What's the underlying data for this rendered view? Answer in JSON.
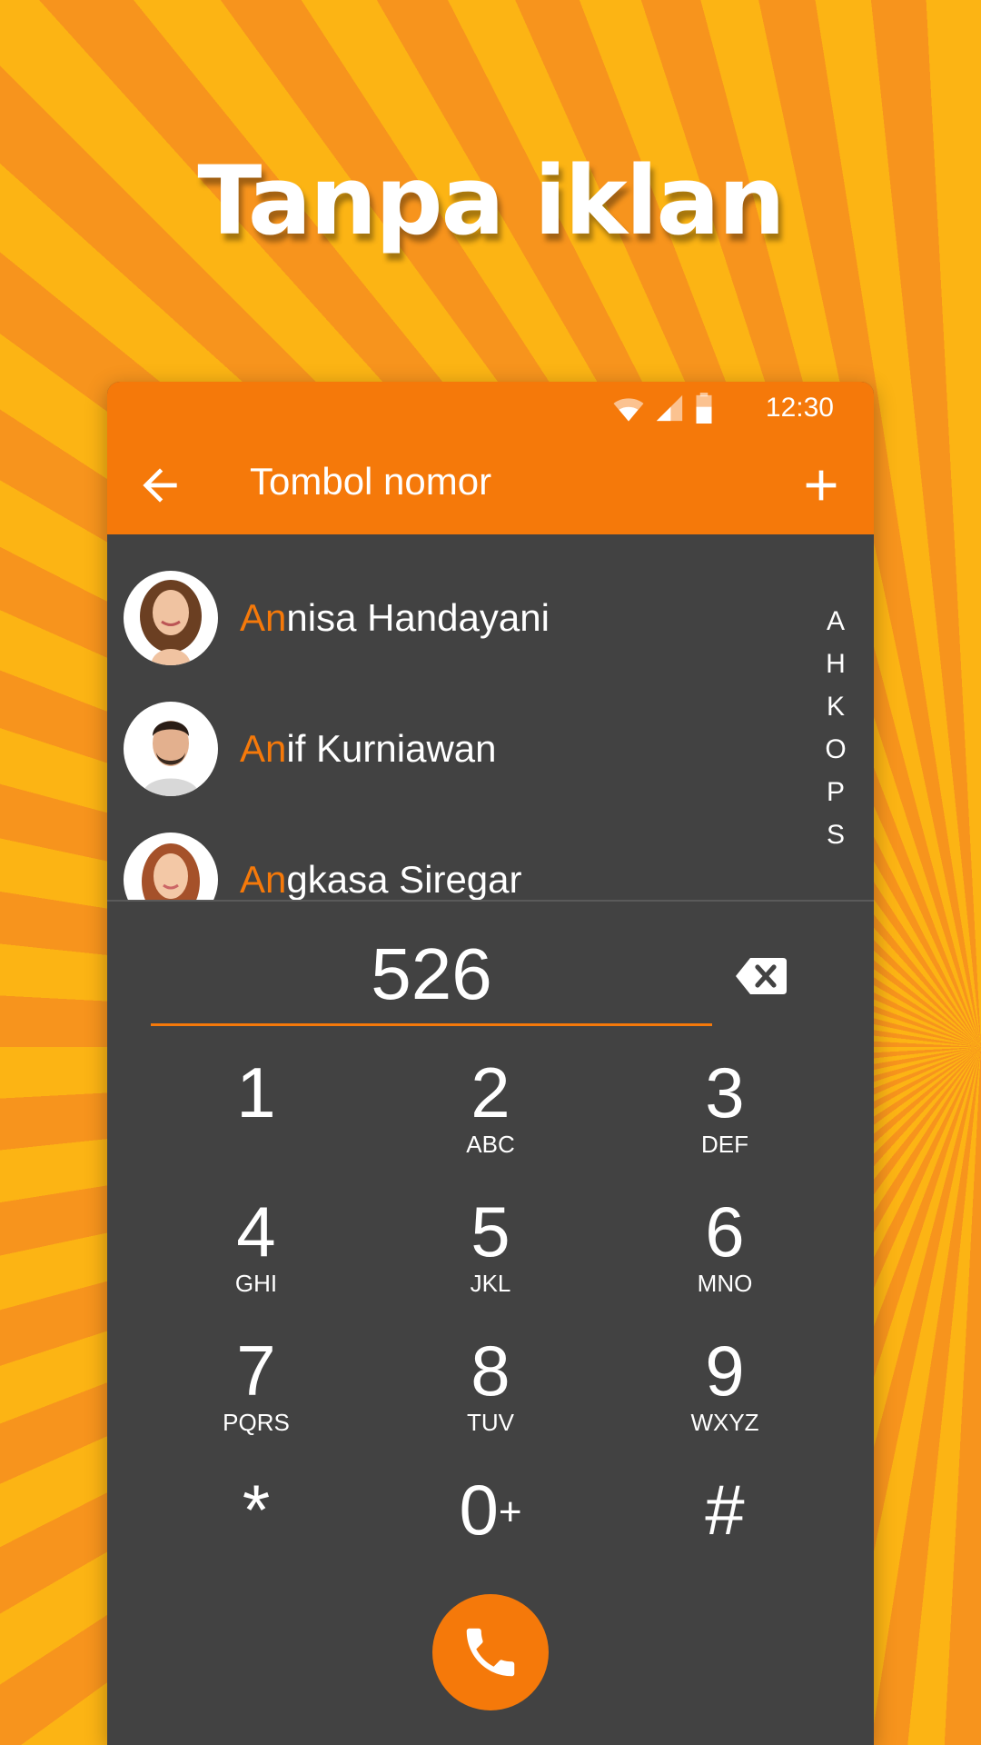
{
  "headline": "Tanpa iklan",
  "status_bar": {
    "time": "12:30",
    "icons": [
      "wifi-icon",
      "signal-icon",
      "battery-icon"
    ]
  },
  "app_bar": {
    "title": "Tombol nomor",
    "back_icon": "arrow-left-icon",
    "add_icon": "plus-icon"
  },
  "contacts": [
    {
      "match": "An",
      "rest": "nisa Handayani"
    },
    {
      "match": "An",
      "rest": "if Kurniawan"
    },
    {
      "match": "An",
      "rest": "gkasa Siregar"
    }
  ],
  "index_letters": [
    "A",
    "H",
    "K",
    "O",
    "P",
    "S"
  ],
  "dialed_number": "526",
  "keypad": [
    {
      "digit": "1",
      "letters": ""
    },
    {
      "digit": "2",
      "letters": "ABC"
    },
    {
      "digit": "3",
      "letters": "DEF"
    },
    {
      "digit": "4",
      "letters": "GHI"
    },
    {
      "digit": "5",
      "letters": "JKL"
    },
    {
      "digit": "6",
      "letters": "MNO"
    },
    {
      "digit": "7",
      "letters": "PQRS"
    },
    {
      "digit": "8",
      "letters": "TUV"
    },
    {
      "digit": "9",
      "letters": "WXYZ"
    },
    {
      "digit": "*",
      "letters": ""
    },
    {
      "digit": "0",
      "letters": "",
      "extra": "+"
    },
    {
      "digit": "#",
      "letters": ""
    }
  ],
  "colors": {
    "accent": "#f5790a",
    "panel": "#424242",
    "background_light": "#fcb414",
    "background_dark": "#f7941d"
  }
}
